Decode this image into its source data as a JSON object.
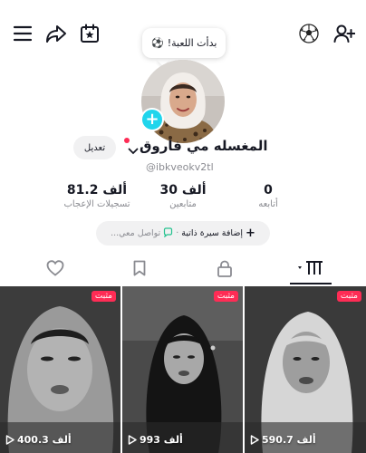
{
  "header": {
    "menu_icon": "menu-icon",
    "share_icon": "share-icon",
    "calendar_icon": "calendar-star-icon",
    "ball_icon": "soccer-ball-icon",
    "add_friend_icon": "add-user-icon"
  },
  "bubble": {
    "text": "بدأت اللعبة!",
    "emoji": "⚽"
  },
  "profile": {
    "name": "المغسله مي فاروق",
    "username": "@ibkveokv2tl",
    "edit_label": "تعديل"
  },
  "stats": {
    "likes_value": "81.2 ألف",
    "likes_label": "تسجيلات الإعجاب",
    "followers_value": "30 ألف",
    "followers_label": "متابعين",
    "following_value": "0",
    "following_label": "أتابعه"
  },
  "bio": {
    "add_label": "إضافة سيرة ذاتية",
    "separator": "·",
    "contact_label": "تواصل معي..."
  },
  "tabs": [
    "videos-grid",
    "private-lock",
    "saved-bookmark",
    "liked-heart"
  ],
  "videos": [
    {
      "pinned": "مثبت",
      "views": "400.3 ألف"
    },
    {
      "pinned": "مثبت",
      "views": "993 ألف"
    },
    {
      "pinned": "مثبت",
      "views": "590.7 ألف"
    }
  ],
  "colors": {
    "accent": "#fe2c55",
    "add_badge": "#20d5ec",
    "muted": "#8a8b91",
    "pill_bg": "#f1f1f2"
  }
}
